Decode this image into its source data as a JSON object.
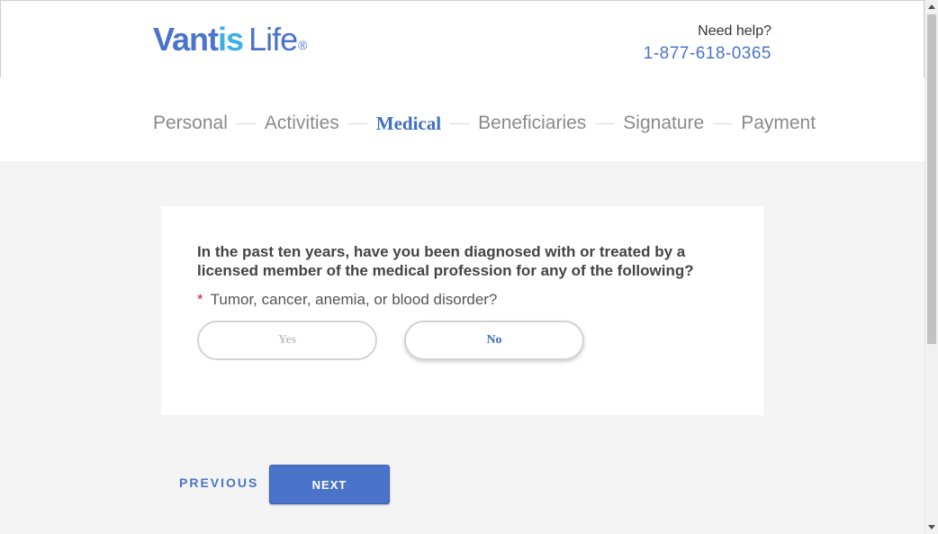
{
  "brand": {
    "logo_part1": "Vant",
    "logo_part2": "is",
    "logo_part3": "Life",
    "logo_registered": "®",
    "colors": {
      "primary": "#4a74c9",
      "secondary": "#39b1e2"
    }
  },
  "help": {
    "label": "Need help?",
    "phone": "1-877-618-0365"
  },
  "steps": [
    {
      "label": "Personal",
      "active": false
    },
    {
      "label": "Activities",
      "active": false
    },
    {
      "label": "Medical",
      "active": true
    },
    {
      "label": "Beneficiaries",
      "active": false
    },
    {
      "label": "Signature",
      "active": false
    },
    {
      "label": "Payment",
      "active": false
    }
  ],
  "question": {
    "text": "In the past ten years, have you been diagnosed with or treated by a licensed member of the medical profession for any of the following?",
    "required_mark": "*",
    "sub_text": "Tumor, cancer, anemia, or blood disorder?",
    "options": {
      "yes": "Yes",
      "no": "No"
    }
  },
  "nav": {
    "previous": "PREVIOUS",
    "next": "NEXT"
  }
}
